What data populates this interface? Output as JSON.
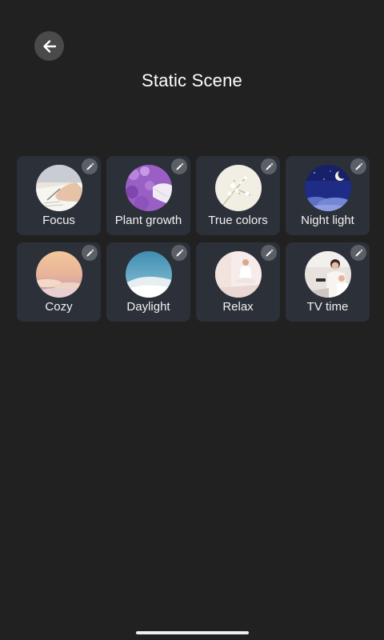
{
  "header": {
    "title": "Static Scene",
    "back_icon": "arrow-left-icon"
  },
  "scenes": [
    {
      "label": "Focus",
      "image": "writing-hand-image",
      "edit_icon": "pencil-icon"
    },
    {
      "label": "Plant growth",
      "image": "lavender-field-image",
      "edit_icon": "pencil-icon"
    },
    {
      "label": "True colors",
      "image": "white-blossoms-image",
      "edit_icon": "pencil-icon"
    },
    {
      "label": "Night light",
      "image": "moon-night-sky-image",
      "edit_icon": "pencil-icon"
    },
    {
      "label": "Cozy",
      "image": "sunset-clouds-image",
      "edit_icon": "pencil-icon"
    },
    {
      "label": "Daylight",
      "image": "sky-sand-dune-image",
      "edit_icon": "pencil-icon"
    },
    {
      "label": "Relax",
      "image": "meditation-image",
      "edit_icon": "pencil-icon"
    },
    {
      "label": "TV time",
      "image": "family-watching-tv-image",
      "edit_icon": "pencil-icon"
    }
  ],
  "colors": {
    "background": "#212121",
    "card": "#2b3039",
    "edit_button": "#5b5f66",
    "back_button": "#4a4a4a"
  }
}
